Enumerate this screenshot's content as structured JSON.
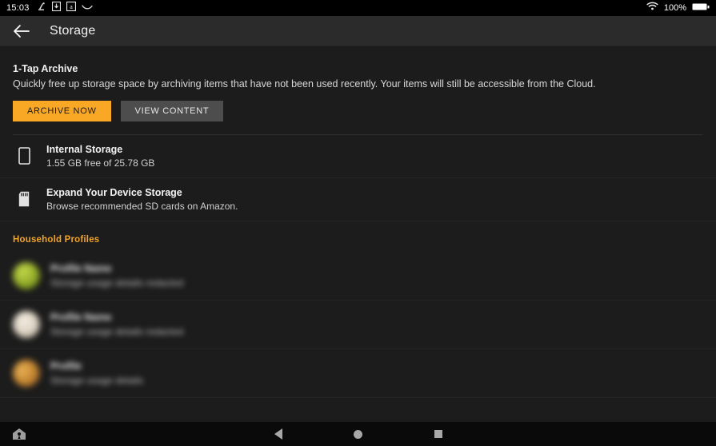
{
  "statusbar": {
    "clock": "15:03",
    "battery_percent": "100%",
    "icons": [
      "amazon-music-icon",
      "download-icon",
      "amazon-app-icon",
      "amazon-smile-icon",
      "wifi-icon",
      "battery-icon"
    ]
  },
  "toolbar": {
    "title": "Storage",
    "back_label": "back-arrow"
  },
  "archive": {
    "title": "1-Tap Archive",
    "description": "Quickly free up storage space by archiving items that have not been used recently. Your items will still be accessible from the Cloud.",
    "archive_button": "ARCHIVE NOW",
    "view_button": "VIEW CONTENT",
    "accent_color": "#f9a825"
  },
  "storage_items": [
    {
      "icon": "device-icon",
      "title": "Internal Storage",
      "subtitle": "1.55 GB free of 25.78 GB"
    },
    {
      "icon": "sd-card-icon",
      "title": "Expand Your Device Storage",
      "subtitle": "Browse recommended SD cards on Amazon."
    }
  ],
  "household": {
    "section_title": "Household Profiles",
    "section_color": "#f0a32a",
    "profiles": [
      {
        "name": "Profile Name",
        "subtitle": "Storage usage details redacted",
        "avatar_color": "#8fa828"
      },
      {
        "name": "Profile Name",
        "subtitle": "Storage usage details redacted",
        "avatar_color": "#ded4c4"
      },
      {
        "name": "Profile",
        "subtitle": "Storage usage details",
        "avatar_color": "#c98a32"
      }
    ]
  },
  "navbar": {
    "home_shortcut": "home-shortcut-icon",
    "back": "back-nav-button",
    "home": "home-nav-button",
    "recents": "recents-nav-button"
  }
}
